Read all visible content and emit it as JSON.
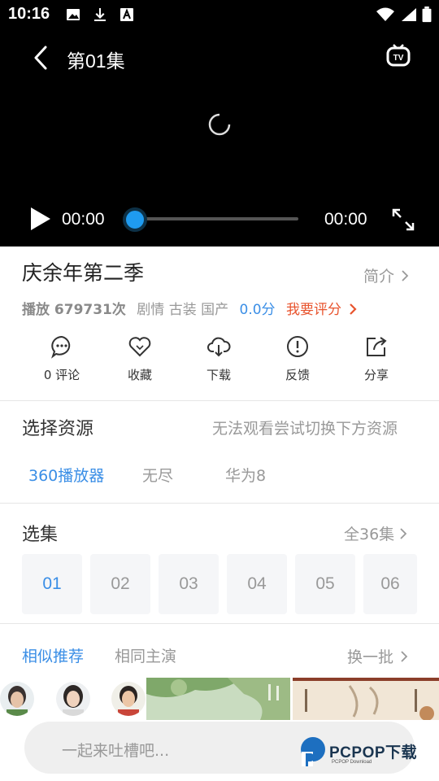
{
  "status_bar": {
    "time": "10:16"
  },
  "player": {
    "episode_title": "第01集",
    "current_time": "00:00",
    "total_time": "00:00",
    "progress": 0
  },
  "show": {
    "title": "庆余年第二季",
    "intro_label": "简介",
    "plays": "播放 679731次",
    "tags": "剧情 古装 国产",
    "score": "0.0分",
    "rate_label": "我要评分"
  },
  "actions": [
    {
      "label": "0 评论",
      "icon": "comment-icon"
    },
    {
      "label": "收藏",
      "icon": "heart-icon"
    },
    {
      "label": "下载",
      "icon": "cloud-download-icon"
    },
    {
      "label": "反馈",
      "icon": "alert-icon"
    },
    {
      "label": "分享",
      "icon": "share-icon"
    }
  ],
  "sources": {
    "title": "选择资源",
    "hint": "无法观看尝试切换下方资源",
    "tabs": [
      "360播放器",
      "无尽",
      "华为8"
    ],
    "active": 0
  },
  "episodes": {
    "title": "选集",
    "total_label": "全36集",
    "items": [
      "01",
      "02",
      "03",
      "04",
      "05",
      "06"
    ],
    "active": 0
  },
  "recommend": {
    "tabs": [
      "相似推荐",
      "相同主演"
    ],
    "refresh_label": "换一批"
  },
  "comment": {
    "placeholder": "一起来吐槽吧..."
  },
  "watermark": {
    "brand": "PCPOP下载",
    "sub": "PCPOP Download"
  },
  "colors": {
    "accent": "#3a8ee6",
    "rate": "#e8542e",
    "seek": "#1f9bf0"
  }
}
